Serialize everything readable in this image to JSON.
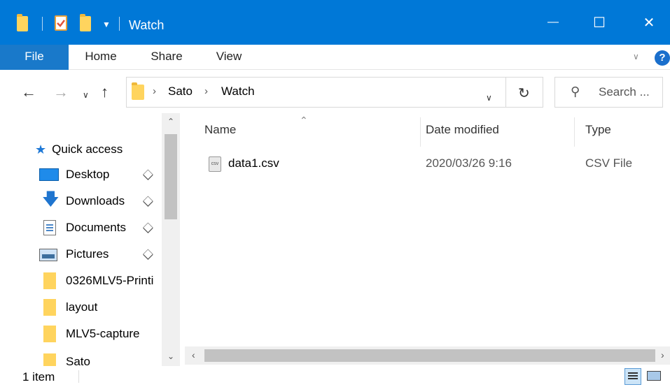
{
  "window": {
    "title": "Watch",
    "minimize_glyph": "—",
    "maximize_glyph": "☐",
    "close_glyph": "✕",
    "accent": "#0078d7"
  },
  "ribbon": {
    "tabs": [
      {
        "label": "File"
      },
      {
        "label": "Home"
      },
      {
        "label": "Share"
      },
      {
        "label": "View"
      }
    ],
    "help_glyph": "?"
  },
  "address": {
    "crumbs": [
      "Sato",
      "Watch"
    ],
    "search_placeholder": "Search ..."
  },
  "nav": {
    "quick_access_label": "Quick access",
    "items": [
      {
        "label": "Desktop",
        "icon": "desktop-icon",
        "pinned": true
      },
      {
        "label": "Downloads",
        "icon": "downloads-icon",
        "pinned": true
      },
      {
        "label": "Documents",
        "icon": "documents-icon",
        "pinned": true
      },
      {
        "label": "Pictures",
        "icon": "pictures-icon",
        "pinned": true
      },
      {
        "label": "0326MLV5-Printi",
        "icon": "folder-icon",
        "pinned": false
      },
      {
        "label": "layout",
        "icon": "folder-icon",
        "pinned": false
      },
      {
        "label": "MLV5-capture",
        "icon": "folder-icon",
        "pinned": false
      },
      {
        "label": "Sato",
        "icon": "folder-icon",
        "pinned": false
      }
    ]
  },
  "columns": {
    "name": "Name",
    "date": "Date modified",
    "type": "Type"
  },
  "files": [
    {
      "name": "data1.csv",
      "date": "2020/03/26 9:16",
      "type": "CSV File",
      "icon_label": "csv"
    }
  ],
  "status": {
    "count": "1 item"
  }
}
